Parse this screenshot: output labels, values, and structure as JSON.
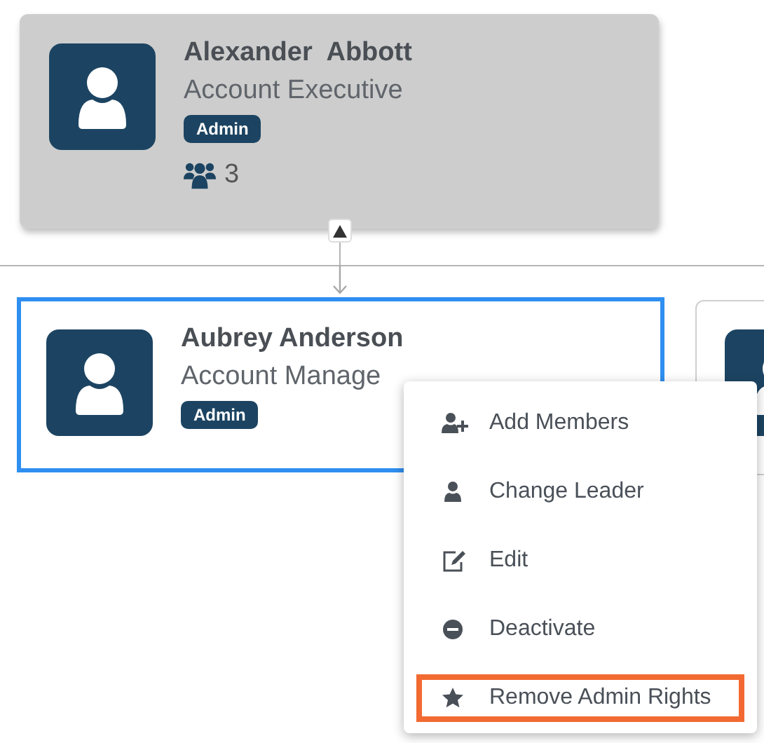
{
  "nodes": [
    {
      "name": "Alexander  Abbott",
      "title": "Account Executive",
      "badge": "Admin",
      "members": "3",
      "dimmed": true,
      "selected": false
    },
    {
      "name": "Aubrey Anderson",
      "title": "Account Manage",
      "badge": "Admin",
      "dimmed": false,
      "selected": true
    },
    {
      "dimmed": false,
      "selected": false
    }
  ],
  "context_menu": {
    "items": [
      {
        "label": "Add Members",
        "highlighted": false
      },
      {
        "label": "Change Leader",
        "highlighted": false
      },
      {
        "label": "Edit",
        "highlighted": false
      },
      {
        "label": "Deactivate",
        "highlighted": false
      },
      {
        "label": "Remove Admin Rights",
        "highlighted": true
      }
    ]
  }
}
